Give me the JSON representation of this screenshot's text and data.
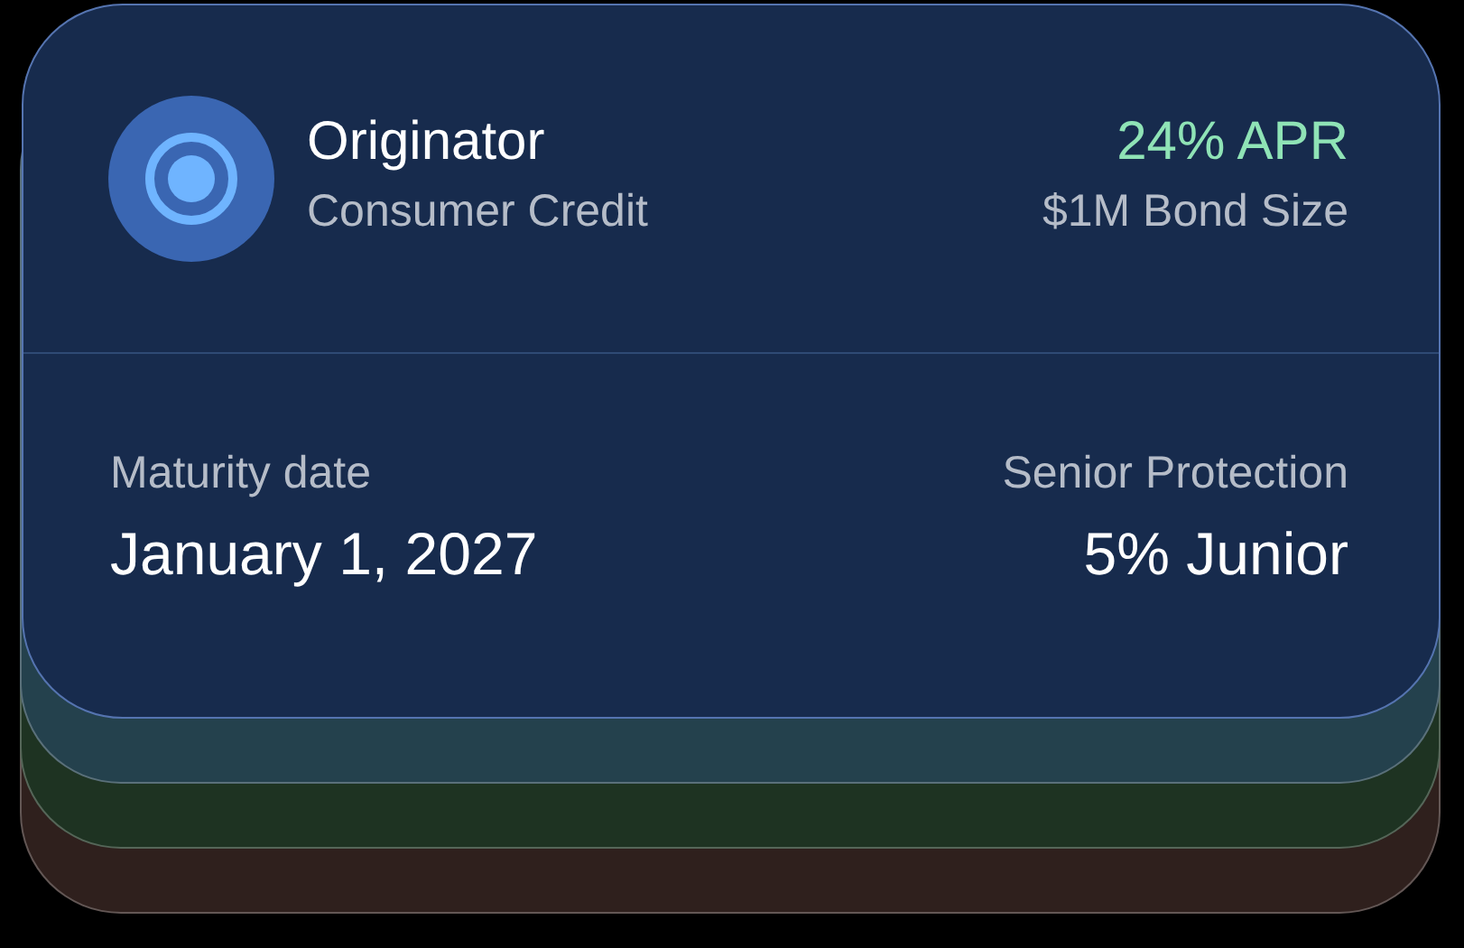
{
  "card": {
    "title": "Originator",
    "subtitle": "Consumer Credit",
    "rate": "24% APR",
    "size": "$1M Bond Size",
    "details": [
      {
        "label": "Maturity date",
        "value": "January 1, 2027"
      },
      {
        "label": "Senior Protection",
        "value": "5% Junior"
      }
    ]
  },
  "stack_layers": [
    {
      "color": "#24414d"
    },
    {
      "color": "#1e3322"
    },
    {
      "color": "#2f201d"
    }
  ]
}
